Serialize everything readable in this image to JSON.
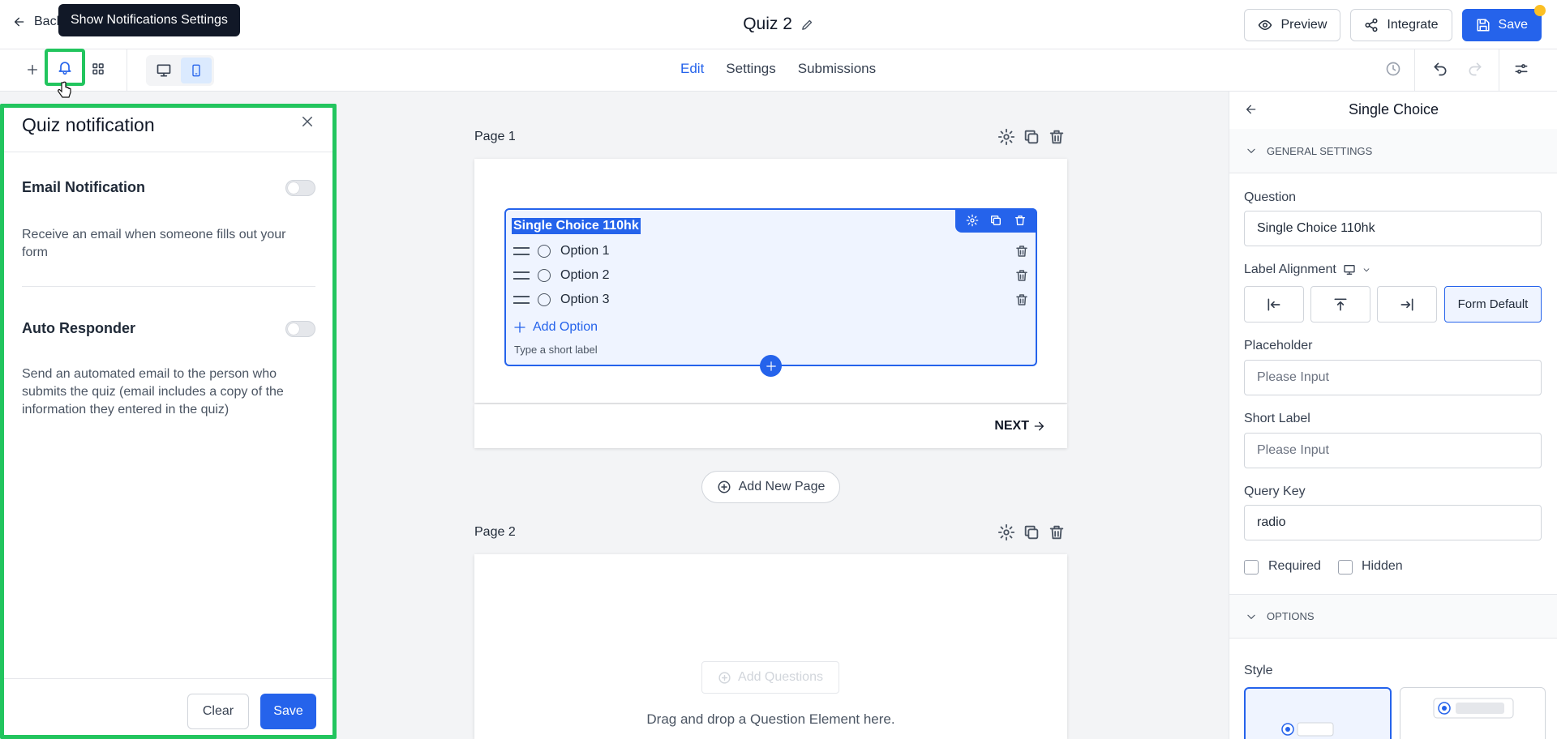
{
  "header": {
    "back_label": "Back",
    "title": "Quiz 2",
    "preview_label": "Preview",
    "integrate_label": "Integrate",
    "save_label": "Save"
  },
  "tooltip": {
    "text": "Show Notifications Settings"
  },
  "tabs": [
    {
      "label": "Edit",
      "active": true
    },
    {
      "label": "Settings",
      "active": false
    },
    {
      "label": "Submissions",
      "active": false
    }
  ],
  "notification_panel": {
    "title": "Quiz notification",
    "email": {
      "title": "Email Notification",
      "description": "Receive an email when someone fills out your form",
      "enabled": false
    },
    "auto_responder": {
      "title": "Auto Responder",
      "description": "Send an automated email to the person who submits the quiz (email includes a copy of the information they entered in the quiz)",
      "enabled": false
    },
    "clear_label": "Clear",
    "save_label": "Save"
  },
  "canvas": {
    "page1": {
      "label": "Page 1",
      "question": {
        "title": "Single Choice 110hk",
        "options": [
          "Option 1",
          "Option 2",
          "Option 3"
        ],
        "add_option_label": "Add Option",
        "short_label_hint": "Type a short label"
      },
      "next_label": "NEXT"
    },
    "add_page_label": "Add New Page",
    "page2": {
      "label": "Page 2",
      "add_questions_label": "Add Questions",
      "drop_hint": "Drag and drop a Question Element here."
    }
  },
  "properties_panel": {
    "title": "Single Choice",
    "general_section": "GENERAL SETTINGS",
    "question_label": "Question",
    "question_value": "Single Choice 110hk",
    "label_alignment_label": "Label Alignment",
    "alignment_selected": "Form Default",
    "placeholder_label": "Placeholder",
    "placeholder_value": "Please Input",
    "short_label_label": "Short Label",
    "short_label_value": "Please Input",
    "query_key_label": "Query Key",
    "query_key_value": "radio",
    "required_label": "Required",
    "hidden_label": "Hidden",
    "options_section": "OPTIONS",
    "style_label": "Style"
  },
  "colors": {
    "accent": "#2563eb",
    "highlight_outline": "#22c55e",
    "badge": "#fbbf24"
  },
  "icons": [
    "arrow-left-icon",
    "pencil-icon",
    "eye-icon",
    "share-icon",
    "save-disk-icon",
    "plus-icon",
    "bell-icon",
    "grid-icon",
    "desktop-icon",
    "mobile-icon",
    "history-icon",
    "undo-icon",
    "redo-icon",
    "sliders-icon",
    "close-icon",
    "gear-icon",
    "copy-icon",
    "trash-icon",
    "drag-handle-icon",
    "chevron-down-icon",
    "arrow-right-icon"
  ]
}
